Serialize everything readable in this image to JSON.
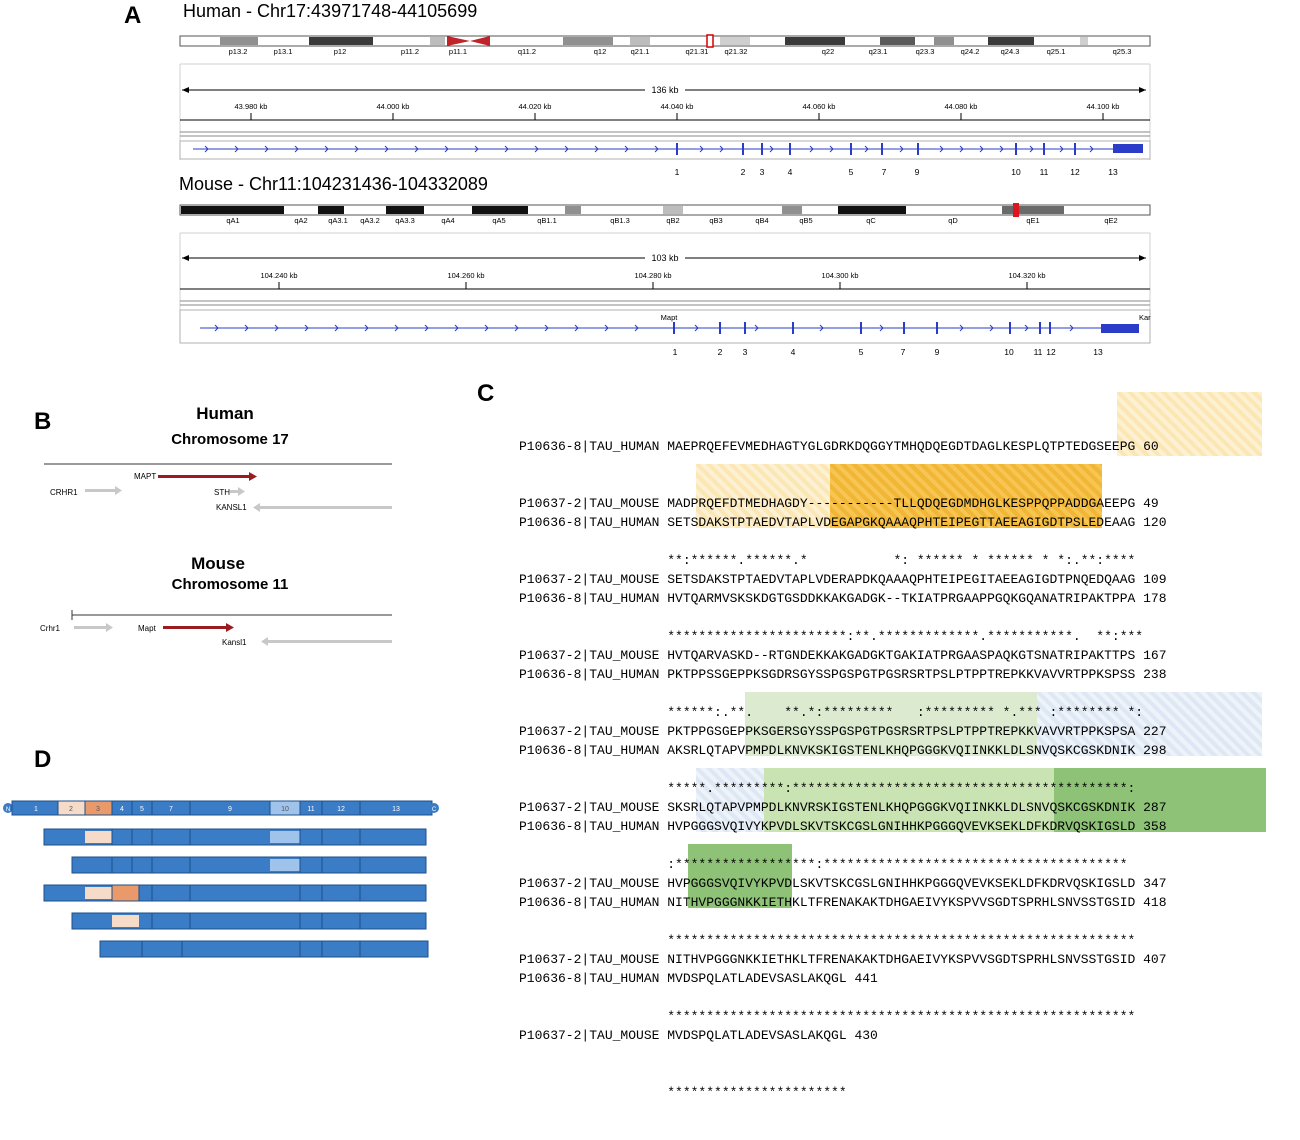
{
  "panels": {
    "a": "A",
    "b": "B",
    "c": "C",
    "d": "D"
  },
  "panel_a": {
    "human": {
      "title": "Human - Chr17:43971748-44105699",
      "bands": [
        "p13.2",
        "p13.1",
        "p12",
        "p11.2",
        "p11.1",
        "q11.2",
        "q12",
        "q21.1",
        "q21.31",
        "q21.32",
        "q22",
        "q23.1",
        "q23.3",
        "q24.2",
        "q24.3",
        "q25.1",
        "q25.3"
      ],
      "span": "136 kb",
      "ticks": [
        "43.980 kb",
        "44.000 kb",
        "44.020 kb",
        "44.040 kb",
        "44.060 kb",
        "44.080 kb",
        "44.100 kb"
      ],
      "exons": [
        "1",
        "2",
        "3",
        "4",
        "5",
        "7",
        "9",
        "10",
        "11",
        "12",
        "13"
      ]
    },
    "mouse": {
      "title": "Mouse - Chr11:104231436-104332089",
      "bands": [
        "qA1",
        "qA2",
        "qA3.1",
        "qA3.2",
        "qA3.3",
        "qA4",
        "qA5",
        "qB1.1",
        "qB1.3",
        "qB2",
        "qB3",
        "qB4",
        "qB5",
        "qC",
        "qD",
        "qE1",
        "qE2"
      ],
      "span": "103 kb",
      "ticks": [
        "104.240 kb",
        "104.260 kb",
        "104.280 kb",
        "104.300 kb",
        "104.320 kb"
      ],
      "gene_label": "Mapt",
      "right_label": "Kar",
      "exons": [
        "1",
        "2",
        "3",
        "4",
        "5",
        "7",
        "9",
        "10",
        "11",
        "12",
        "13"
      ]
    }
  },
  "panel_b": {
    "human": {
      "species": "Human",
      "chromosome": "Chromosome 17",
      "genes": [
        "CRHR1",
        "MAPT",
        "STH",
        "KANSL1"
      ]
    },
    "mouse": {
      "species": "Mouse",
      "chromosome": "Chromosome 11",
      "genes": [
        "Crhr1",
        "Mapt",
        "Kansl1"
      ]
    }
  },
  "panel_c": {
    "blocks": [
      {
        "human": "P10636-8|TAU_HUMAN MAEPRQEFEVMEDHAGTYGLGDRKDQGGYTMHQDQEGDTDAGLKESPLQTPTEDGSEEPG 60",
        "mouse": "P10637-2|TAU_MOUSE MADPRQEFDTMEDHAGDY-----------TLLQDQEGDMDHGLKESPPQPPADDGAEEPG 49",
        "cons": "                   **:******.******.*           *: ****** * ****** * *:.**:****"
      },
      {
        "human": "P10636-8|TAU_HUMAN SETSDAKSTPTAEDVTAPLVDEGAPGKQAAAQPHTEIPEGTTAEEAGIGDTPSLEDEAAG 120",
        "mouse": "P10637-2|TAU_MOUSE SETSDAKSTPTAEDVTAPLVDERAPDKQAAAQPHTEIPEGITAEEAGIGDTPNQEDQAAG 109",
        "cons": "                   ***********************:**.*************.***********.  **:***"
      },
      {
        "human": "P10636-8|TAU_HUMAN HVTQARMVSKSKDGTGSDDKKAKGADGK--TKIATPRGAAPPGQKGQANATRIPAKTPPA 178",
        "mouse": "P10637-2|TAU_MOUSE HVTQARVASKD--RTGNDEKKAKGADGKTGAKIATPRGAASPAQKGTSNATRIPAKTTPS 167",
        "cons": "                   ******:.**.    **.*:*********   :********* *.*** :******** *:"
      },
      {
        "human": "P10636-8|TAU_HUMAN PKTPPSSGEPPKSGDRSGYSSPGSPGTPGSRSRTPSLPTPPTREPKKVAVVRTPPKSPSS 238",
        "mouse": "P10637-2|TAU_MOUSE PKTPPGSGEPPKSGERSGYSSPGSPGTPGSRSRTPSLPTPPTREPKKVAVVRTPPKSPSA 227",
        "cons": "                   *****.*********:*******************************************:"
      },
      {
        "human": "P10636-8|TAU_HUMAN AKSRLQTAPVPMPDLKNVKSKIGSTENLKHQPGGGKVQIINKKLDLSNVQSKCGSKDNIK 298",
        "mouse": "P10637-2|TAU_MOUSE SKSRLQTAPVPMPDLKNVRSKIGSTENLKHQPGGGKVQIINKKLDLSNVQSKCGSKDNIK 287",
        "cons": "                   :******************:***************************************"
      },
      {
        "human": "P10636-8|TAU_HUMAN HVPGGGSVQIVYKPVDLSKVTSKCGSLGNIHHKPGGGQVEVKSEKLDFKDRVQSKIGSLD 358",
        "mouse": "P10637-2|TAU_MOUSE HVPGGGSVQIVYKPVDLSKVTSKCGSLGNIHHKPGGGQVEVKSEKLDFKDRVQSKIGSLD 347",
        "cons": "                   ************************************************************"
      },
      {
        "human": "P10636-8|TAU_HUMAN NITHVPGGGNKKIETHKLTFRENAKAKTDHGAEIVYKSPVVSGDTSPRHLSNVSSTGSID 418",
        "mouse": "P10637-2|TAU_MOUSE NITHVPGGGNKKIETHKLTFRENAKAKTDHGAEIVYKSPVVSGDTSPRHLSNVSSTGSID 407",
        "cons": "                   ************************************************************"
      },
      {
        "human": "P10636-8|TAU_HUMAN MVDSPQLATLADEVSASLAKQGL 441",
        "mouse": "P10637-2|TAU_MOUSE MVDSPQLATLADEVSASLAKQGL 430",
        "cons": "                   ***********************"
      }
    ]
  },
  "panel_d": {
    "exons": [
      "1",
      "2",
      "3",
      "4",
      "5",
      "7",
      "9",
      "10",
      "11",
      "12",
      "13"
    ],
    "n_label": "N",
    "c_label": "C",
    "colors": {
      "bar": "#3a7cc6",
      "bar_border": "#1c4f8a",
      "e2": "#f6dcc8",
      "e3": "#ea9a6a",
      "e10": "#9fc3ea"
    }
  }
}
